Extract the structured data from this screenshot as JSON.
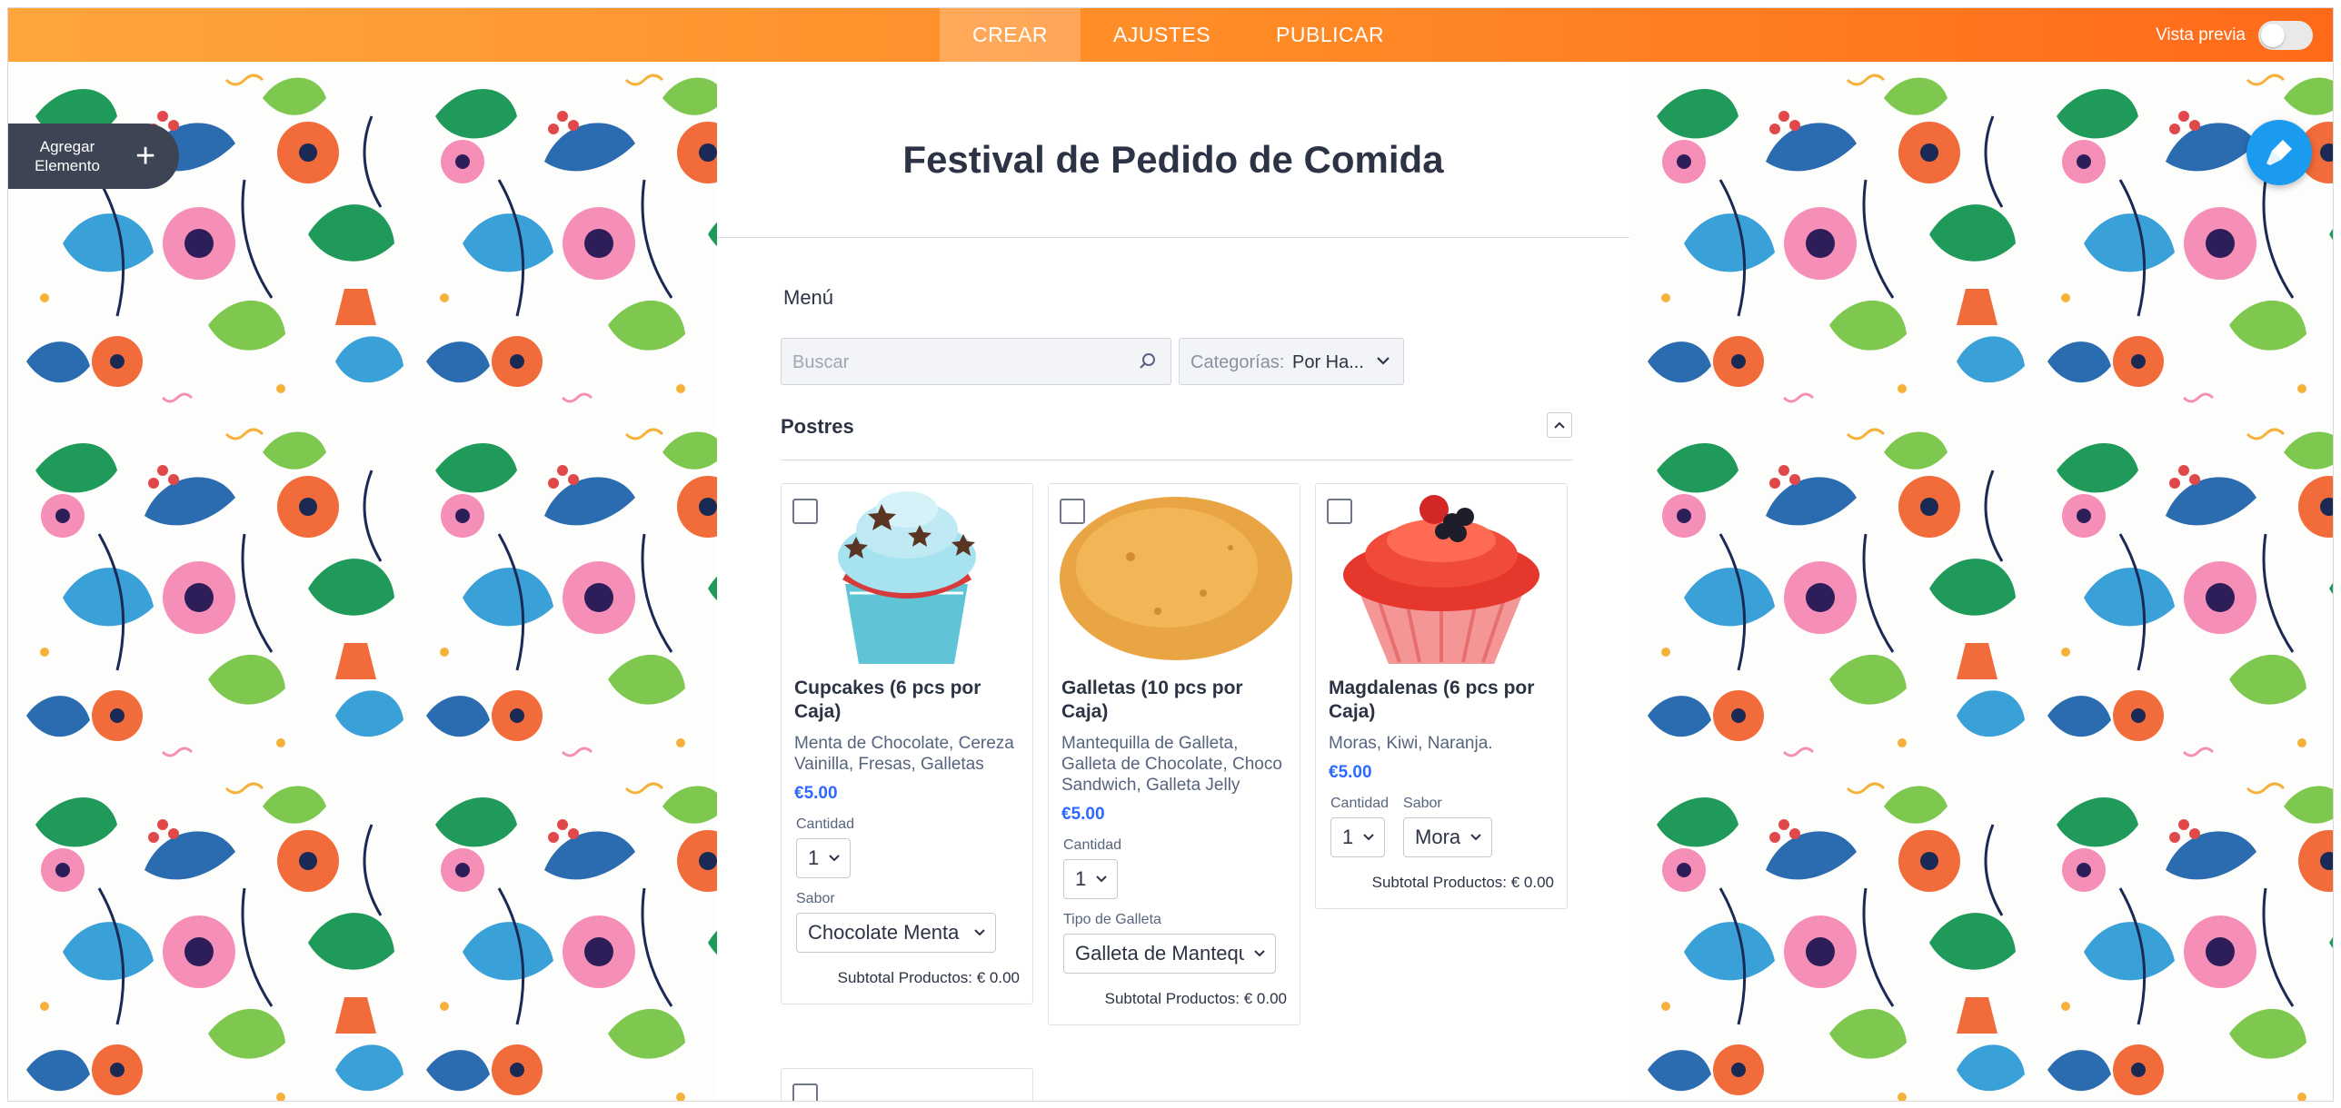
{
  "topbar": {
    "tabs": [
      {
        "label": "CREAR",
        "active": true
      },
      {
        "label": "AJUSTES",
        "active": false
      },
      {
        "label": "PUBLICAR",
        "active": false
      }
    ],
    "preview_label": "Vista previa",
    "accent_gradient": [
      "#ffa53a",
      "#ff6a1a"
    ]
  },
  "sidebar": {
    "add_element_line1": "Agregar",
    "add_element_line2": "Elemento",
    "add_icon": "plus-icon"
  },
  "form": {
    "title": "Festival de Pedido de Comida",
    "menu_label": "Menú",
    "search_placeholder": "Buscar",
    "category_key": "Categorías:",
    "category_value": "Por Ha...",
    "section_title": "Postres",
    "subtotal_label": "Subtotal Productos:",
    "subtotal_value": "€ 0.00",
    "products": [
      {
        "name": "Cupcakes (6 pcs por Caja)",
        "description": "Menta de Chocolate, Cereza Vainilla, Fresas, Galletas",
        "price": "€5.00",
        "quantity_label": "Cantidad",
        "quantity_value": "1",
        "option_label": "Sabor",
        "option_value": "Chocolate Menta"
      },
      {
        "name": "Galletas (10 pcs por Caja)",
        "description": "Mantequilla de Galleta, Galleta de Chocolate, Choco Sandwich, Galleta Jelly",
        "price": "€5.00",
        "quantity_label": "Cantidad",
        "quantity_value": "1",
        "option_label": "Tipo de Galleta",
        "option_value": "Galleta de Mantequilla"
      },
      {
        "name": "Magdalenas (6 pcs por Caja)",
        "description": "Moras, Kiwi, Naranja.",
        "price": "€5.00",
        "quantity_label": "Cantidad",
        "quantity_value": "1",
        "option_label": "Sabor",
        "option_value": "Mora"
      }
    ]
  },
  "colors": {
    "price": "#2e69ff",
    "text": "#2c3345",
    "brush_button": "#1a9bf0"
  }
}
